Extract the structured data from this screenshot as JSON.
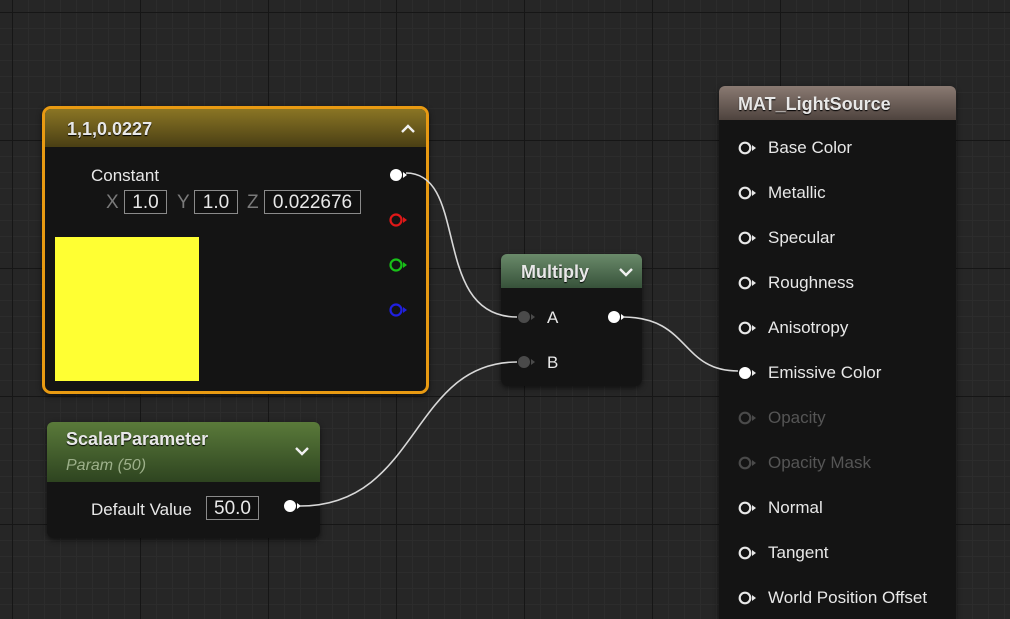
{
  "constant_node": {
    "title": "1,1,0.0227",
    "label": "Constant",
    "x_label": "X",
    "x_value": "1.0",
    "y_label": "Y",
    "y_value": "1.0",
    "z_label": "Z",
    "z_value": "0.022676",
    "preview_color": "#ffff33",
    "selected_border_color": "#e89a12"
  },
  "scalar_node": {
    "title": "ScalarParameter",
    "subtitle": "Param (50)",
    "field_label": "Default Value",
    "field_value": "50.0"
  },
  "multiply_node": {
    "title": "Multiply",
    "input_a": "A",
    "input_b": "B"
  },
  "material_node": {
    "title": "MAT_LightSource",
    "pins": [
      {
        "label": "Base Color",
        "enabled": true
      },
      {
        "label": "Metallic",
        "enabled": true
      },
      {
        "label": "Specular",
        "enabled": true
      },
      {
        "label": "Roughness",
        "enabled": true
      },
      {
        "label": "Anisotropy",
        "enabled": true
      },
      {
        "label": "Emissive Color",
        "enabled": true,
        "connected": true
      },
      {
        "label": "Opacity",
        "enabled": false
      },
      {
        "label": "Opacity Mask",
        "enabled": false
      },
      {
        "label": "Normal",
        "enabled": true
      },
      {
        "label": "Tangent",
        "enabled": true
      },
      {
        "label": "World Position Offset",
        "enabled": true
      }
    ]
  },
  "icons": {
    "collapse": "chevron-up-icon",
    "expand": "chevron-down-icon",
    "pin": "pin-circle-icon"
  },
  "colors": {
    "red_channel": "#e01818",
    "green_channel": "#18c018",
    "blue_channel": "#2020e0",
    "wire": "#d8d8d8",
    "disabled_text": "#555555"
  }
}
